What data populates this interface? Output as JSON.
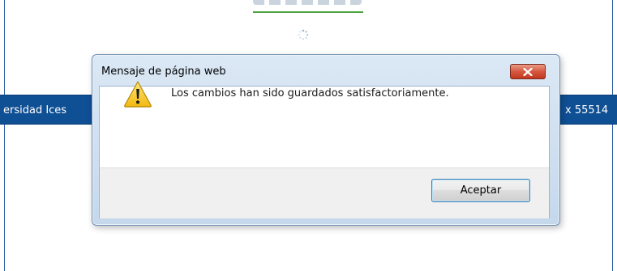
{
  "dialog": {
    "title": "Mensaje de página web",
    "message": "Los cambios han sido guardados satisfactoriamente.",
    "accept_label": "Aceptar",
    "icon": "warning-icon",
    "close_icon": "close-icon"
  },
  "background": {
    "bar_left_text": "ersidad Ices",
    "bar_right_text": "x 55514",
    "bar_color": "#0f4f94",
    "loading_icon": "spinner-icon"
  },
  "colors": {
    "close_button": "#d5573f",
    "accent_green": "#4aa33c",
    "warning_yellow": "#f2c21b"
  }
}
